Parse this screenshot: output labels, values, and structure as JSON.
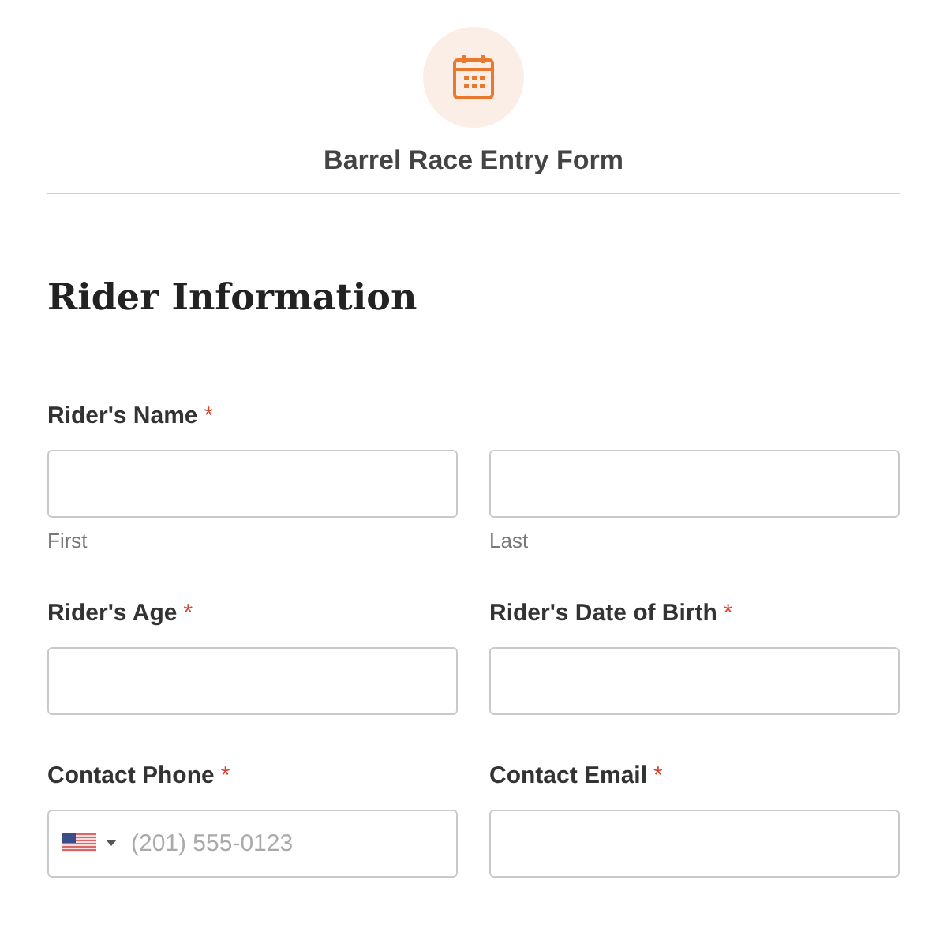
{
  "header": {
    "title": "Barrel Race Entry Form"
  },
  "section": {
    "title": "Rider Information"
  },
  "fields": [
    {
      "kind": "name",
      "label": "Rider's Name",
      "required_mark": "*",
      "subfields": [
        {
          "sublabel": "First"
        },
        {
          "sublabel": "Last"
        }
      ]
    },
    {
      "kind": "text",
      "label": "Rider's Age",
      "required_mark": "*"
    },
    {
      "kind": "text",
      "label": "Rider's Date of Birth",
      "required_mark": "*"
    },
    {
      "kind": "phone",
      "label": "Contact Phone",
      "required_mark": "*",
      "placeholder": "(201) 555-0123"
    },
    {
      "kind": "email",
      "label": "Contact Email",
      "required_mark": "*"
    }
  ]
}
